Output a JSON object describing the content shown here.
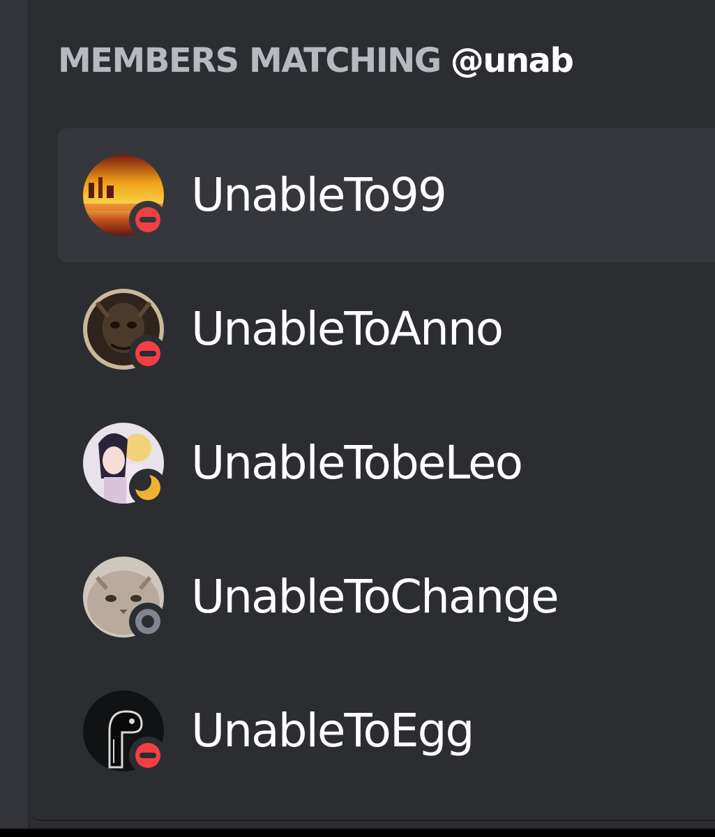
{
  "header": {
    "label": "MEMBERS MATCHING",
    "query": "@unab"
  },
  "members": [
    {
      "username": "UnableTo99",
      "status": "dnd",
      "avatar_icon": "sunset-landscape-avatar",
      "selected": true
    },
    {
      "username": "UnableToAnno",
      "status": "dnd",
      "avatar_icon": "dark-creature-avatar",
      "selected": false
    },
    {
      "username": "UnableTobeLeo",
      "status": "idle",
      "avatar_icon": "anime-character-avatar",
      "selected": false
    },
    {
      "username": "UnableToChange",
      "status": "offline",
      "avatar_icon": "cat-face-avatar",
      "selected": false
    },
    {
      "username": "UnableToEgg",
      "status": "dnd",
      "avatar_icon": "black-dinosaur-avatar",
      "selected": false
    }
  ],
  "colors": {
    "background": "#2b2d31",
    "selected_row": "#35373c",
    "header_text": "#b5bac1",
    "username_text": "#ffffff",
    "dnd": "#f23f43",
    "idle": "#f0b232",
    "offline": "#80848e"
  }
}
